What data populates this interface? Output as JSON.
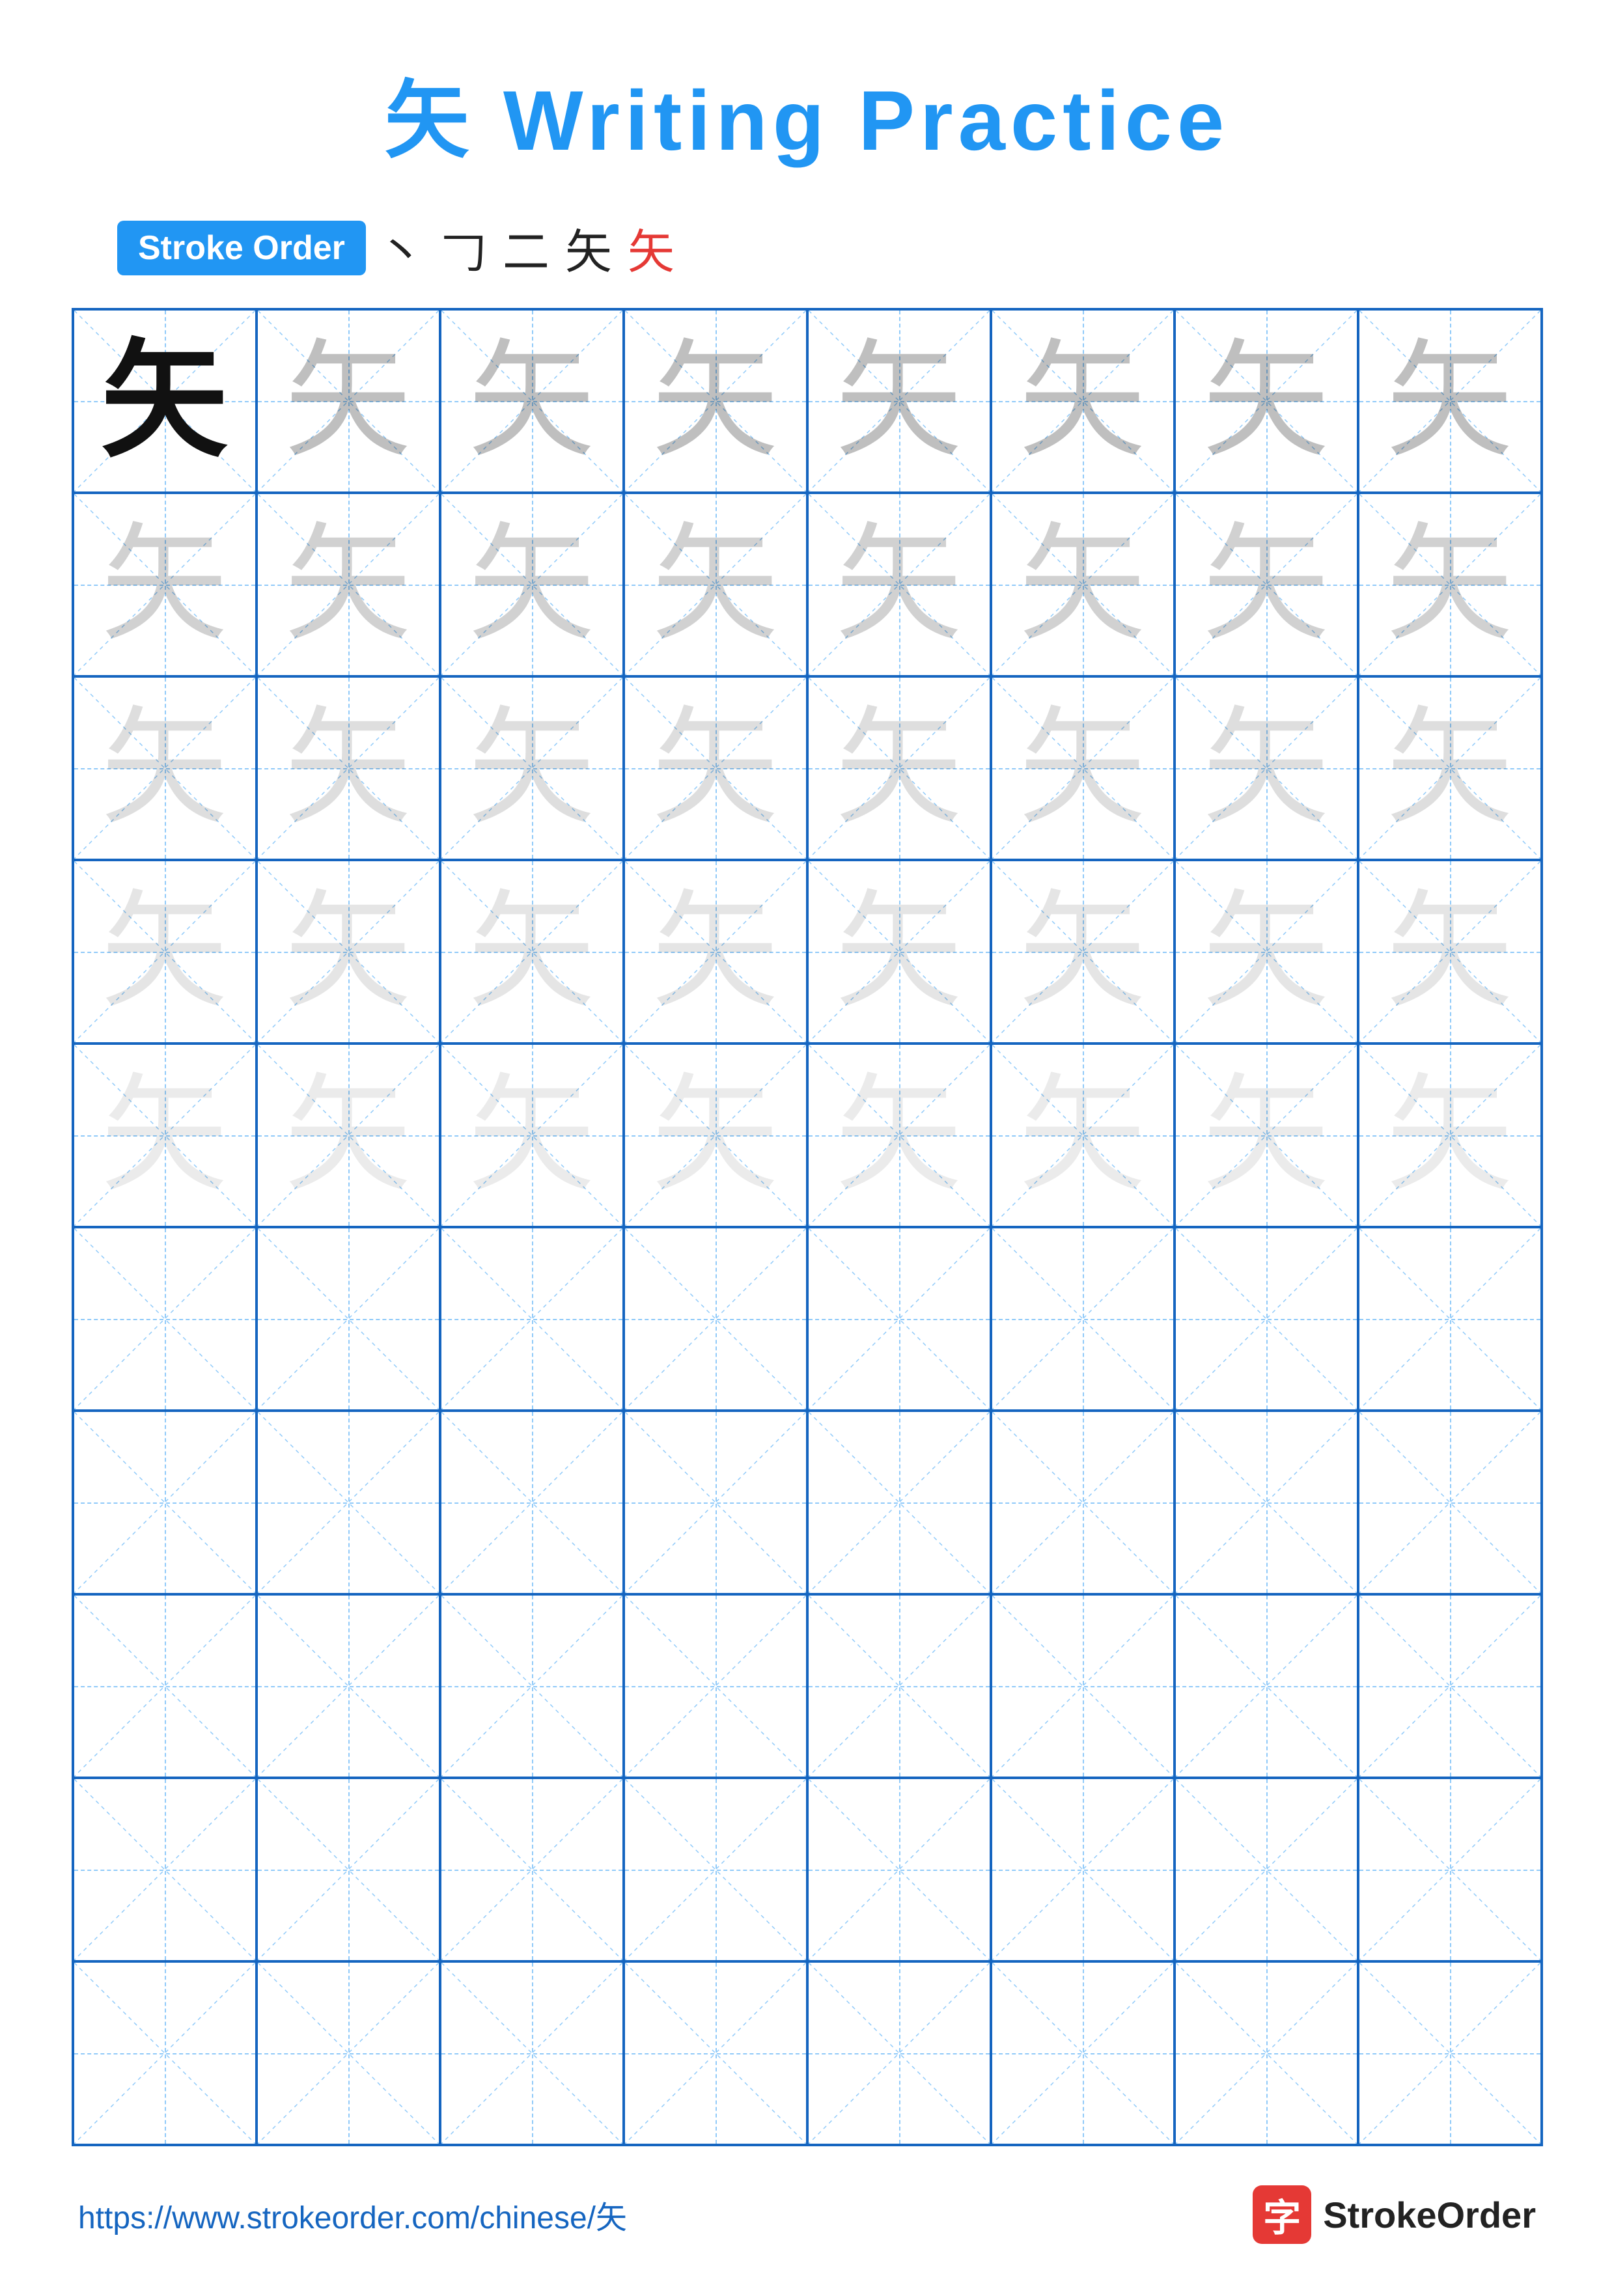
{
  "title": {
    "prefix_char": "矢",
    "text": " Writing Practice"
  },
  "stroke_order": {
    "badge_label": "Stroke Order",
    "steps": [
      "丶",
      "𠃌",
      "二",
      "矢",
      "矢"
    ],
    "steps_colors": [
      "dark",
      "dark",
      "dark",
      "dark",
      "red"
    ]
  },
  "grid": {
    "rows": 10,
    "cols": 8,
    "char": "矢",
    "char_filled_rows": 5,
    "fade_levels": [
      "black",
      "gray1",
      "gray1",
      "gray2",
      "gray2",
      "gray3",
      "gray3",
      "gray4",
      "gray5",
      "gray5"
    ]
  },
  "footer": {
    "url": "https://www.strokeorder.com/chinese/矢",
    "logo_char": "字",
    "logo_name": "StrokeOrder"
  }
}
